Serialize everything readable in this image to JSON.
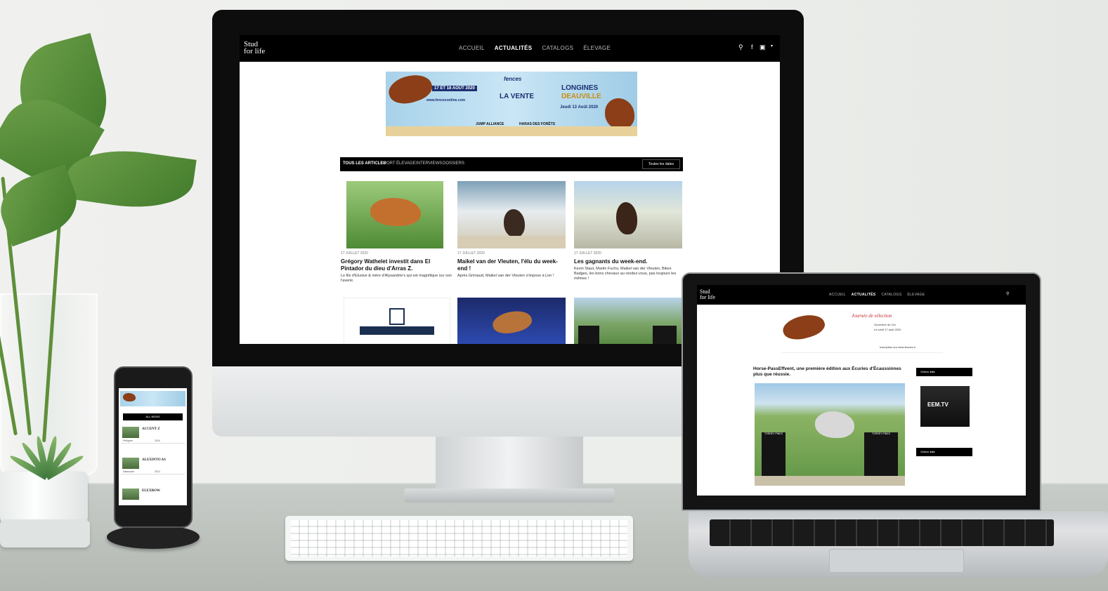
{
  "imac": {
    "logo_line1": "Stud",
    "logo_line2": "for life",
    "nav": [
      "ACCUEIL",
      "ACTUALITÉS",
      "CATALOGS",
      "ÉLEVAGE"
    ],
    "banner": {
      "date": "17 ET 18 AOÛT 2020",
      "brand": "fences",
      "event": "LA VENTE",
      "website": "www.fencesonline.com",
      "partner1": "JUMP ALLIANCE",
      "partner2": "HARAS DES FORÊTS",
      "right_top": "LONGINES",
      "right_mid": "DEAUVILLE",
      "right_date": "Jeudi 13 Août 2020"
    },
    "filters": [
      "TOUS LES ARTICLES",
      "SPORT",
      "ÉLEVAGE",
      "INTERVIEWS",
      "DOSSIERS"
    ],
    "filter_select": "Toutes les dates",
    "cards": [
      {
        "date": "17 JUILLET 2020",
        "title": "Grégory Wathelet investit dans El Pintador du dieu d'Arras Z.",
        "excerpt": "Le fils d'Elusive & mère d'Alysandrie's qui est magnifique sur son l'avenir."
      },
      {
        "date": "17 JUILLET 2020",
        "title": "Maikel van der Vleuten, l'élu du week-end !",
        "excerpt": "Après Grimaud, Maikel van der Vleuten s'impose à Lier !"
      },
      {
        "date": "17 JUILLET 2020",
        "title": "Les gagnants du week-end.",
        "excerpt": "Kevin Staut, Martin Fuchs, Maikel van der Vleuten, Bikes Badges, les bons chevaux au rendez-vous, pas toujours les mêmes !"
      }
    ]
  },
  "laptop": {
    "logo_line1": "Stud",
    "logo_line2": "for life",
    "nav": [
      "ACCUEIL",
      "ACTUALITÉS",
      "CATALOGS",
      "ÉLEVAGE"
    ],
    "banner_headline": "Journée de sélection",
    "banner_detail1": "Ouverture de 11h",
    "banner_detail2": "Le lundi 17 août 2020",
    "banner_footer": "Inscription sur www.fences.fr",
    "article_title": "Horse-PassEffvent, une première édition aux Écuries d'Écaussinnes plus que réussie.",
    "side_label1": "Vidéos",
    "side_label2": "Vidéos",
    "side_tv": "EEM.TV",
    "brand_panel": "TORREY PINES",
    "brand_panel_2": "TORREY PINES"
  },
  "phone": {
    "button": "ALL NEWS",
    "rows": [
      {
        "title": "ACCENT Z",
        "k": "Pédigrée",
        "v": "2016"
      },
      {
        "title": "ALEXINTO AS",
        "k": "Naissance",
        "v": "2013"
      },
      {
        "title": "ELEXBOW",
        "k": "",
        "v": ""
      }
    ]
  },
  "colors": {
    "brand_black": "#000000",
    "banner_blue": "#1b2f72",
    "horse_brown": "#8b3e17",
    "accent_red": "#c0282d"
  }
}
